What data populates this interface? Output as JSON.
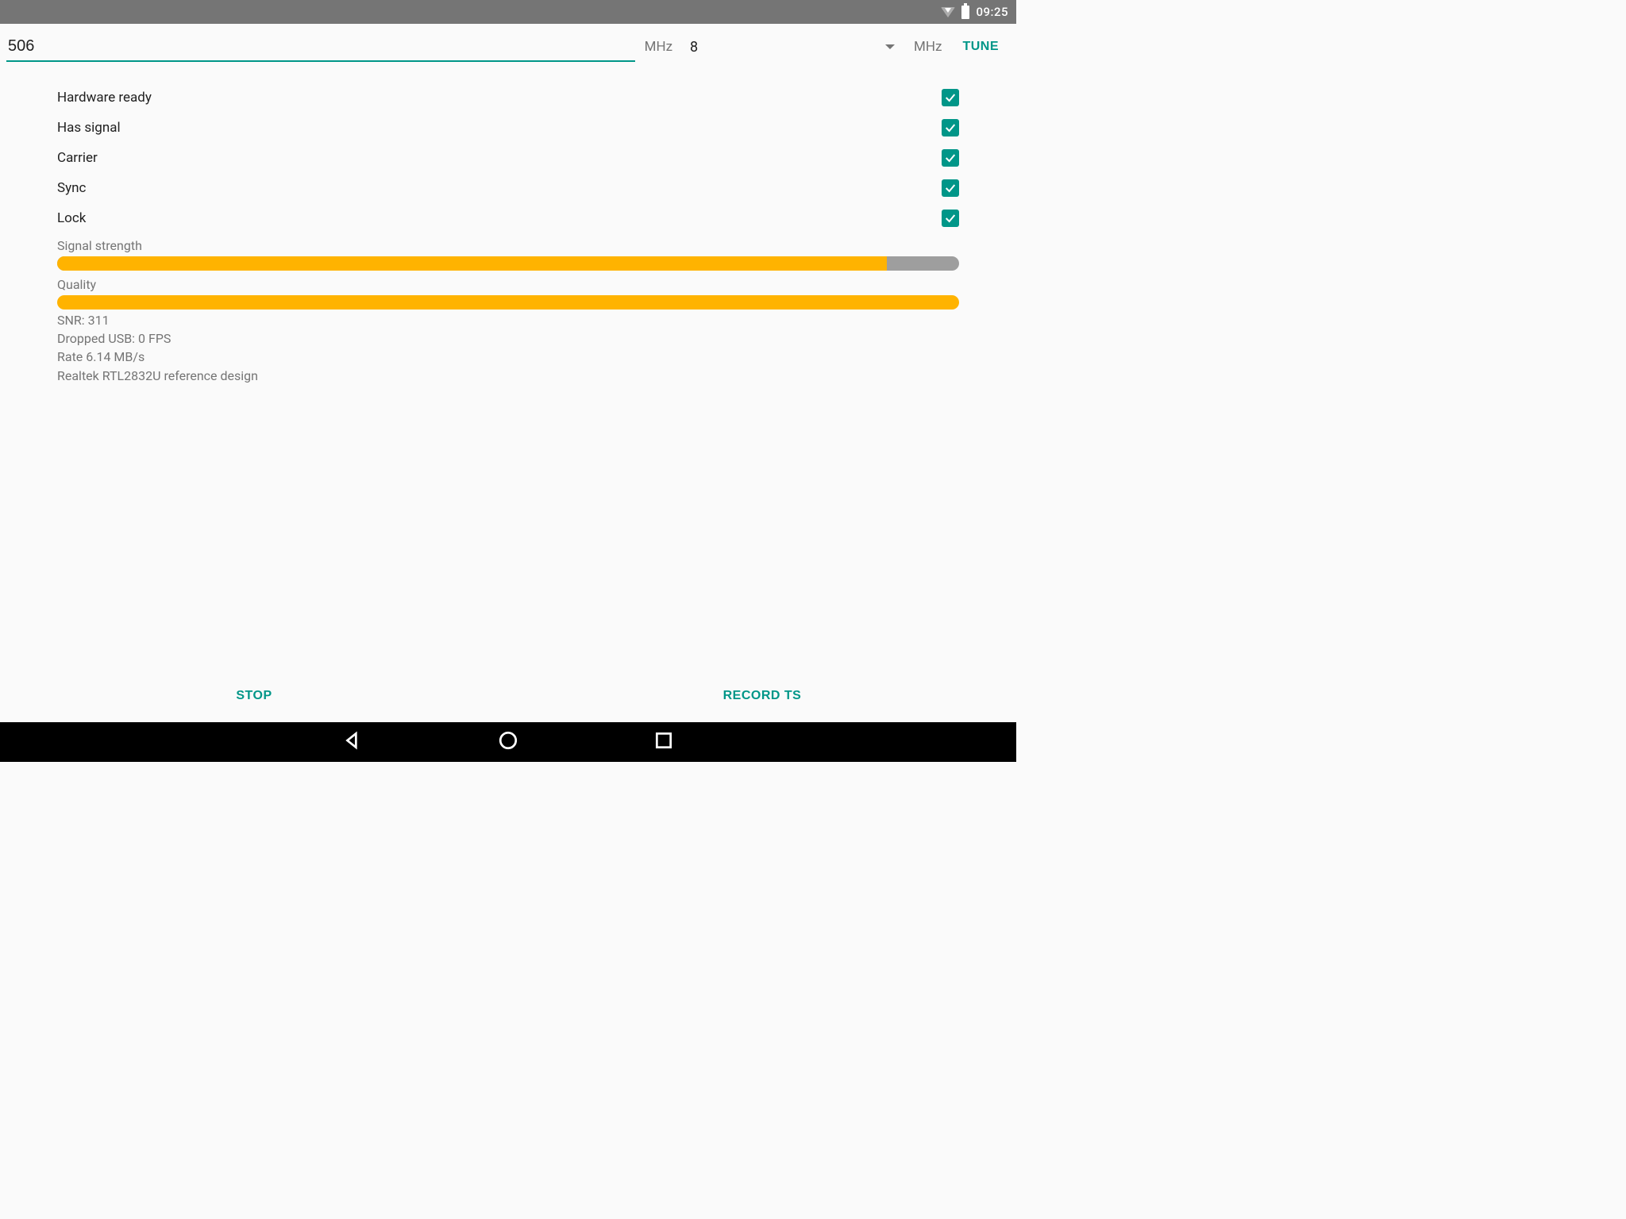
{
  "status_bar": {
    "time": "09:25"
  },
  "tuner": {
    "frequency": "506",
    "freq_unit": "MHz",
    "bandwidth": "8",
    "bw_unit": "MHz",
    "tune_label": "TUNE"
  },
  "checks": {
    "hardware_ready": {
      "label": "Hardware ready",
      "checked": true
    },
    "has_signal": {
      "label": "Has signal",
      "checked": true
    },
    "carrier": {
      "label": "Carrier",
      "checked": true
    },
    "sync": {
      "label": "Sync",
      "checked": true
    },
    "lock": {
      "label": "Lock",
      "checked": true
    }
  },
  "bars": {
    "signal": {
      "label": "Signal strength",
      "percent": 92
    },
    "quality": {
      "label": "Quality",
      "percent": 100
    }
  },
  "info": {
    "snr": "SNR: 311",
    "dropped": "Dropped USB: 0 FPS",
    "rate": "Rate 6.14 MB/s",
    "device": "Realtek RTL2832U reference design"
  },
  "actions": {
    "stop": "STOP",
    "record": "RECORD TS"
  }
}
